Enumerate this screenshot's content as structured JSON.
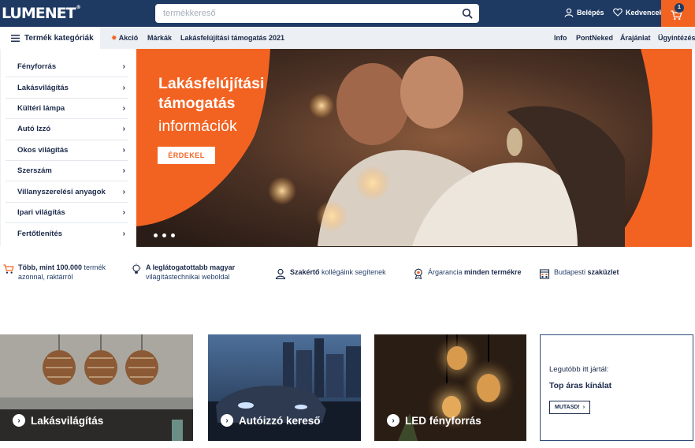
{
  "header": {
    "logo": "LUMENET",
    "logo_mark": "®",
    "search_placeholder": "termékkereső",
    "login_label": "Belépés",
    "favorites_label": "Kedvencek",
    "cart_count": "1"
  },
  "nav": {
    "categories_label": "Termék kategóriák",
    "items": [
      "Akció",
      "Márkák",
      "Lakásfelújítási támogatás 2021"
    ],
    "right_items": [
      "Info",
      "PontNeked",
      "Árajánlat",
      "Ügyintézés"
    ]
  },
  "sidebar": {
    "items": [
      {
        "label": "Fényforrás"
      },
      {
        "label": "Lakásvilágítás"
      },
      {
        "label": "Kültéri lámpa"
      },
      {
        "label": "Autó Izzó"
      },
      {
        "label": "Okos világítás"
      },
      {
        "label": "Szerszám"
      },
      {
        "label": "Villanyszerelési anyagok"
      },
      {
        "label": "Ipari világítás"
      },
      {
        "label": "Fertőtlenítés"
      }
    ]
  },
  "hero": {
    "title": "Lakásfelújítási támogatás",
    "subtitle": "információk",
    "button": "ÉRDEKEL",
    "slides": 3,
    "active_slide": 1
  },
  "features": [
    {
      "bold": "Több, mint 100.000",
      "text": " termék",
      "line2": "azonnal, raktárról",
      "icon": "cart-icon"
    },
    {
      "bold": "A leglátogatottabb magyar",
      "text": "",
      "line2": "világítástechnikai weboldal",
      "icon": "bulb-icon"
    },
    {
      "bold": "Szakértő",
      "text": " kollégáink segítenek",
      "line2": "",
      "icon": "expert-icon"
    },
    {
      "bold": "",
      "text": "Árgarancia ",
      "bold2": "minden termékre",
      "line2": "",
      "icon": "badge-icon"
    },
    {
      "bold": "",
      "text": "Budapesti ",
      "bold2": "szaküzlet",
      "line2": "",
      "icon": "store-icon"
    }
  ],
  "cards": [
    {
      "label": "Lakásvilágítás"
    },
    {
      "label": "Autóizzó kereső"
    },
    {
      "label": "LED fényforrás"
    }
  ],
  "recent": {
    "title": "Legutóbb itt jártál:",
    "offer": "Top áras kínálat",
    "button": "MUTASD!"
  },
  "colors": {
    "brand_navy": "#1e3a63",
    "accent_orange": "#f26322"
  }
}
